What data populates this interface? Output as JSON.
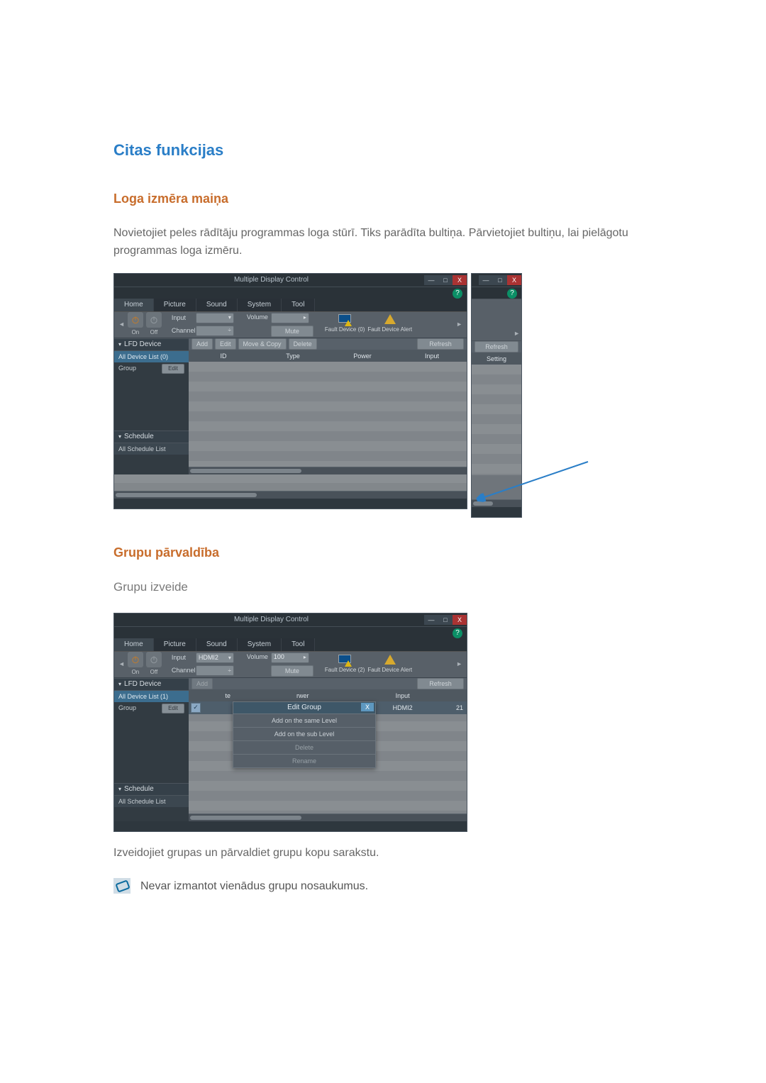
{
  "headings": {
    "section1": "Citas funkcijas",
    "h2_resize": "Loga izmēra maiņa",
    "resize_para": "Novietojiet peles rādītāju programmas loga stūrī. Tiks parādīta bultiņa. Pārvietojiet bultiņu, lai pielāgotu programmas loga izmēru.",
    "h2_group": "Grupu pārvaldība",
    "h3_group_create": "Grupu izveide",
    "group_para": "Izveidojiet grupas un pārvaldiet grupu kopu sarakstu.",
    "note": "Nevar izmantot vienādus grupu nosaukumus."
  },
  "app": {
    "title": "Multiple Display Control",
    "tabs": {
      "home": "Home",
      "picture": "Picture",
      "sound": "Sound",
      "system": "System",
      "tool": "Tool"
    },
    "power": {
      "on": "On",
      "off": "Off"
    },
    "fields": {
      "input": "Input",
      "channel": "Channel",
      "volume": "Volume",
      "mute": "Mute",
      "hdmi2": "HDMI2",
      "vol_value": "100"
    },
    "fault": {
      "count": "Fault Device (0)",
      "alert": "Fault Device Alert",
      "count2": "Fault Device (2)"
    },
    "side": {
      "lfd": "LFD Device",
      "all0": "All Device List (0)",
      "all1": "All Device List (1)",
      "group": "Group",
      "edit": "Edit",
      "schedule": "Schedule",
      "all_sched": "All Schedule List"
    },
    "actions": {
      "add": "Add",
      "edit": "Edit",
      "move_copy": "Move & Copy",
      "delete": "Delete",
      "refresh": "Refresh"
    },
    "cols": {
      "id": "ID",
      "type": "Type",
      "power": "Power",
      "input": "Input",
      "setting": "Setting"
    },
    "popup": {
      "title": "Edit Group",
      "same": "Add on the same Level",
      "sub": "Add on the sub Level",
      "del": "Delete",
      "ren": "Rename",
      "close": "X"
    },
    "row": {
      "input": "HDMI2",
      "num": "21",
      "rwer": "rwer",
      "te": "te"
    }
  }
}
